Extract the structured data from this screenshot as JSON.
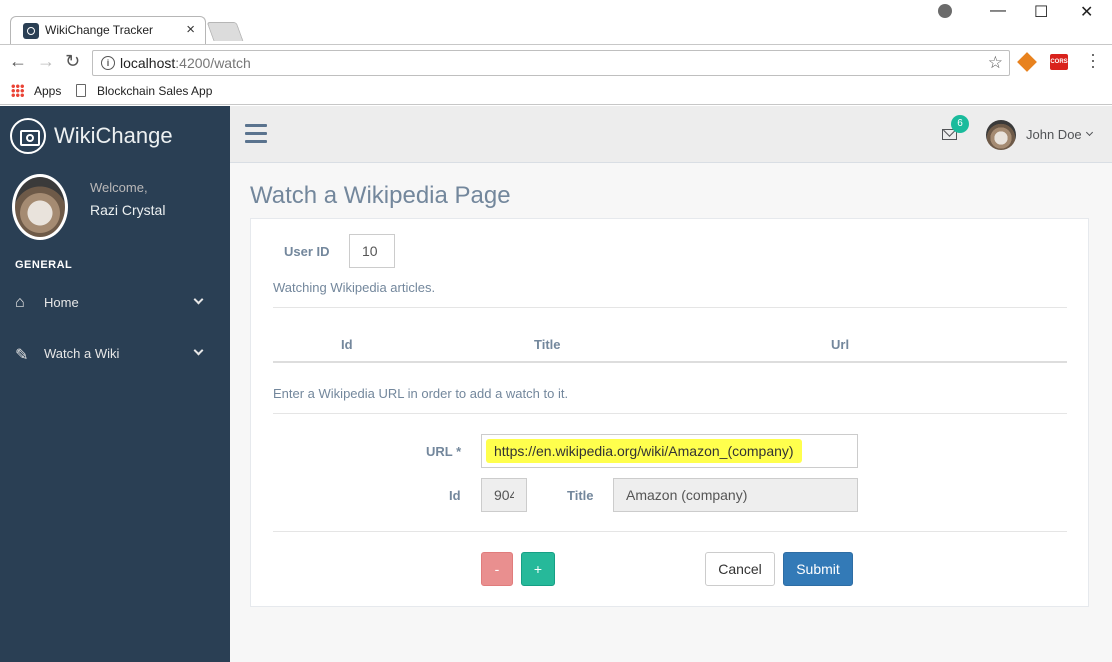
{
  "browser": {
    "tab_title": "WikiChange Tracker",
    "tab_close": "×",
    "url_host": "localhost",
    "url_path": ":4200/watch",
    "bookmarks": [
      "Apps",
      "Blockchain Sales App"
    ],
    "window_controls": {
      "minimize": "—",
      "maximize": "☐",
      "close": "✕"
    },
    "ext_cors_label": "CORS"
  },
  "sidebar": {
    "brand": "WikiChange",
    "welcome": "Welcome,",
    "username": "Razi Crystal",
    "section": "GENERAL",
    "items": [
      {
        "label": "Home",
        "icon": "home-icon"
      },
      {
        "label": "Watch a Wiki",
        "icon": "edit-icon"
      }
    ]
  },
  "topnav": {
    "mail_count": "6",
    "user_name": "John Doe"
  },
  "page": {
    "title": "Watch a Wikipedia Page",
    "user_id_label": "User ID",
    "user_id_value": "10",
    "watching_text": "Watching Wikipedia articles.",
    "table_headers": [
      "Id",
      "Title",
      "Url"
    ],
    "add_help": "Enter a Wikipedia URL in order to add a watch to it.",
    "url_label": "URL *",
    "url_value": "https://en.wikipedia.org/wiki/Amazon_(company)",
    "id_label": "Id",
    "id_value": "904",
    "title_label": "Title",
    "title_value": "Amazon (company)",
    "buttons": {
      "remove": "-",
      "add": "+",
      "cancel": "Cancel",
      "submit": "Submit"
    }
  },
  "colors": {
    "sidebar_bg": "#2a3f54",
    "accent_green": "#26b99a",
    "primary_blue": "#337ab7",
    "danger_red": "#e98f8f",
    "url_highlight": "#ffff4d"
  }
}
